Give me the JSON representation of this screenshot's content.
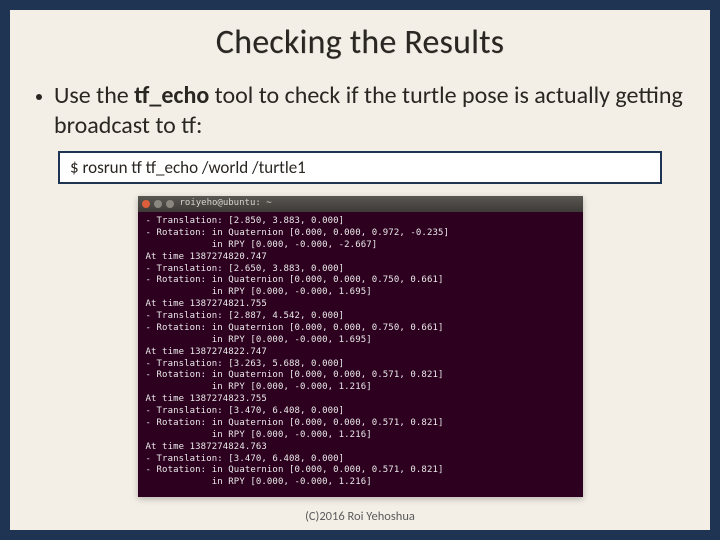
{
  "title": "Checking the Results",
  "bullet": {
    "pre": "Use the ",
    "bold": "tf_echo",
    "post": " tool to check if the turtle pose is actually getting broadcast to tf:"
  },
  "command": "$ rosrun tf tf_echo /world /turtle1",
  "terminal": {
    "window_title": "roiyeho@ubuntu: ~",
    "lines": [
      "- Translation: [2.850, 3.883, 0.000]",
      "- Rotation: in Quaternion [0.000, 0.000, 0.972, -0.235]",
      "            in RPY [0.000, -0.000, -2.667]",
      "At time 1387274820.747",
      "- Translation: [2.650, 3.883, 0.000]",
      "- Rotation: in Quaternion [0.000, 0.000, 0.750, 0.661]",
      "            in RPY [0.000, -0.000, 1.695]",
      "At time 1387274821.755",
      "- Translation: [2.887, 4.542, 0.000]",
      "- Rotation: in Quaternion [0.000, 0.000, 0.750, 0.661]",
      "            in RPY [0.000, -0.000, 1.695]",
      "At time 1387274822.747",
      "- Translation: [3.263, 5.688, 0.000]",
      "- Rotation: in Quaternion [0.000, 0.000, 0.571, 0.821]",
      "            in RPY [0.000, -0.000, 1.216]",
      "At time 1387274823.755",
      "- Translation: [3.470, 6.408, 0.000]",
      "- Rotation: in Quaternion [0.000, 0.000, 0.571, 0.821]",
      "            in RPY [0.000, -0.000, 1.216]",
      "At time 1387274824.763",
      "- Translation: [3.470, 6.408, 0.000]",
      "- Rotation: in Quaternion [0.000, 0.000, 0.571, 0.821]",
      "            in RPY [0.000, -0.000, 1.216]"
    ]
  },
  "footer": "(C)2016 Roi Yehoshua"
}
